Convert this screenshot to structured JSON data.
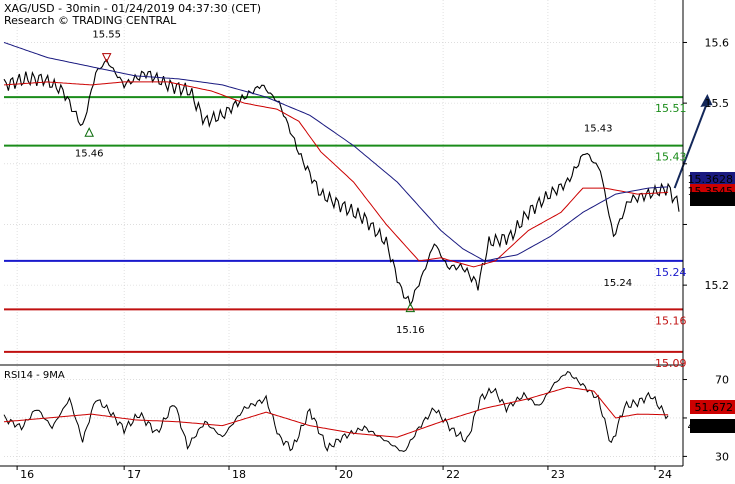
{
  "header": {
    "line1": "XAG/USD - 30min - 01/24/2019 04:37:30 (CET)",
    "line2": "Research © TRADING CENTRAL"
  },
  "colors": {
    "price": "#000000",
    "ma_fast": "#cc0000",
    "ma_slow": "#1a1a80",
    "resistance": "#1a8c1a",
    "pivot": "#1a1acc",
    "support": "#c01010",
    "arrow": "#14285a",
    "grid": "#cccccc",
    "rsi_line": "#000000",
    "rsi_ma": "#cc0000"
  },
  "chart_data": [
    {
      "type": "line",
      "name": "price-panel",
      "x_labels": [
        "16",
        "17",
        "18",
        "20",
        "22",
        "23",
        "24"
      ],
      "x_label_bar_index": [
        6,
        55,
        103,
        152,
        201,
        249,
        298
      ],
      "ylim": [
        15.07,
        15.67
      ],
      "y_ticks": [
        15.2,
        15.3,
        15.4,
        15.5,
        15.6
      ],
      "y_tick_labels": [
        "15.2",
        "",
        "",
        "15.5",
        "15.6"
      ],
      "grid": true,
      "series": [
        {
          "role": "price",
          "anchors": [
            [
              0,
              15.53
            ],
            [
              10,
              15.54
            ],
            [
              18,
              15.54
            ],
            [
              27,
              15.52
            ],
            [
              36,
              15.46
            ],
            [
              42,
              15.55
            ],
            [
              47,
              15.57
            ],
            [
              55,
              15.53
            ],
            [
              65,
              15.55
            ],
            [
              75,
              15.53
            ],
            [
              85,
              15.52
            ],
            [
              92,
              15.47
            ],
            [
              100,
              15.48
            ],
            [
              110,
              15.51
            ],
            [
              118,
              15.53
            ],
            [
              126,
              15.5
            ],
            [
              136,
              15.41
            ],
            [
              145,
              15.35
            ],
            [
              155,
              15.33
            ],
            [
              165,
              15.31
            ],
            [
              175,
              15.27
            ],
            [
              182,
              15.19
            ],
            [
              186,
              15.17
            ],
            [
              192,
              15.22
            ],
            [
              197,
              15.27
            ],
            [
              203,
              15.23
            ],
            [
              210,
              15.23
            ],
            [
              217,
              15.2
            ],
            [
              222,
              15.27
            ],
            [
              232,
              15.28
            ],
            [
              240,
              15.32
            ],
            [
              250,
              15.35
            ],
            [
              258,
              15.37
            ],
            [
              266,
              15.42
            ],
            [
              273,
              15.39
            ],
            [
              279,
              15.28
            ],
            [
              286,
              15.34
            ],
            [
              295,
              15.35
            ],
            [
              304,
              15.36
            ],
            [
              309,
              15.33
            ]
          ]
        },
        {
          "role": "ma_fast",
          "anchors": [
            [
              0,
              15.53
            ],
            [
              20,
              15.535
            ],
            [
              40,
              15.53
            ],
            [
              55,
              15.535
            ],
            [
              75,
              15.535
            ],
            [
              95,
              15.52
            ],
            [
              110,
              15.5
            ],
            [
              125,
              15.49
            ],
            [
              135,
              15.47
            ],
            [
              145,
              15.42
            ],
            [
              160,
              15.37
            ],
            [
              175,
              15.3
            ],
            [
              190,
              15.24
            ],
            [
              200,
              15.245
            ],
            [
              215,
              15.23
            ],
            [
              225,
              15.24
            ],
            [
              240,
              15.29
            ],
            [
              255,
              15.32
            ],
            [
              265,
              15.36
            ],
            [
              275,
              15.36
            ],
            [
              290,
              15.35
            ],
            [
              304,
              15.353
            ]
          ]
        },
        {
          "role": "ma_slow",
          "anchors": [
            [
              0,
              15.6
            ],
            [
              20,
              15.575
            ],
            [
              40,
              15.56
            ],
            [
              60,
              15.545
            ],
            [
              80,
              15.54
            ],
            [
              100,
              15.53
            ],
            [
              120,
              15.51
            ],
            [
              140,
              15.48
            ],
            [
              160,
              15.43
            ],
            [
              180,
              15.37
            ],
            [
              200,
              15.29
            ],
            [
              210,
              15.26
            ],
            [
              220,
              15.24
            ],
            [
              235,
              15.25
            ],
            [
              250,
              15.28
            ],
            [
              265,
              15.32
            ],
            [
              280,
              15.35
            ],
            [
              295,
              15.36
            ],
            [
              304,
              15.362
            ]
          ]
        }
      ],
      "levels": [
        {
          "value": 15.51,
          "label": "15.51",
          "role": "resistance"
        },
        {
          "value": 15.43,
          "label": "15.43",
          "role": "resistance"
        },
        {
          "value": 15.24,
          "label": "15.24",
          "role": "pivot"
        },
        {
          "value": 15.16,
          "label": "15.16",
          "role": "support"
        },
        {
          "value": 15.09,
          "label": "15.09",
          "role": "support"
        }
      ],
      "last_values": [
        {
          "value": 15.3628,
          "label": "15.3628",
          "role": "ma_slow"
        },
        {
          "value": 15.3545,
          "label": "15.3545",
          "role": "ma_fast"
        },
        {
          "value": 15.354,
          "label": "15.354",
          "role": "price"
        }
      ],
      "annotations": [
        {
          "text": "15.55",
          "bar": 47,
          "value": 15.575,
          "marker": "down-triangle",
          "label_value": 15.615
        },
        {
          "text": "15.46",
          "bar": 39,
          "value": 15.452,
          "marker": "up-triangle",
          "label_value": 15.419
        },
        {
          "text": "15.16",
          "bar": 186,
          "value": 15.163,
          "marker": "up-triangle",
          "label_value": 15.128
        },
        {
          "text": "15.43",
          "bar": 272,
          "value": 15.46,
          "marker": "",
          "label_value": 15.46
        },
        {
          "text": "15.24",
          "bar": 281,
          "value": 15.205,
          "marker": "",
          "label_value": 15.205
        }
      ],
      "projection": {
        "from": [
          307,
          15.36
        ],
        "to": [
          322,
          15.515
        ]
      }
    },
    {
      "type": "line",
      "name": "rsi-panel",
      "title": "RSI14 - 9MA",
      "ylim": [
        25,
        76
      ],
      "y_ticks": [
        30,
        50,
        70
      ],
      "y_tick_labels": [
        "30",
        "",
        "70"
      ],
      "series": [
        {
          "role": "rsi_line",
          "anchors": [
            [
              0,
              50
            ],
            [
              8,
              45
            ],
            [
              15,
              55
            ],
            [
              22,
              45
            ],
            [
              30,
              60
            ],
            [
              36,
              38
            ],
            [
              42,
              60
            ],
            [
              48,
              54
            ],
            [
              55,
              44
            ],
            [
              62,
              52
            ],
            [
              70,
              42
            ],
            [
              78,
              58
            ],
            [
              84,
              35
            ],
            [
              92,
              48
            ],
            [
              100,
              40
            ],
            [
              110,
              55
            ],
            [
              120,
              60
            ],
            [
              126,
              40
            ],
            [
              132,
              34
            ],
            [
              140,
              54
            ],
            [
              148,
              34
            ],
            [
              155,
              40
            ],
            [
              165,
              45
            ],
            [
              175,
              38
            ],
            [
              183,
              32
            ],
            [
              190,
              45
            ],
            [
              197,
              55
            ],
            [
              205,
              44
            ],
            [
              212,
              38
            ],
            [
              218,
              60
            ],
            [
              224,
              65
            ],
            [
              230,
              55
            ],
            [
              238,
              62
            ],
            [
              245,
              56
            ],
            [
              252,
              68
            ],
            [
              258,
              74
            ],
            [
              266,
              66
            ],
            [
              272,
              60
            ],
            [
              278,
              36
            ],
            [
              284,
              56
            ],
            [
              290,
              58
            ],
            [
              296,
              62
            ],
            [
              304,
              50
            ]
          ]
        },
        {
          "role": "rsi_ma",
          "anchors": [
            [
              0,
              48
            ],
            [
              20,
              50
            ],
            [
              40,
              52
            ],
            [
              60,
              49
            ],
            [
              80,
              48
            ],
            [
              100,
              46
            ],
            [
              120,
              53
            ],
            [
              140,
              46
            ],
            [
              160,
              42
            ],
            [
              180,
              40
            ],
            [
              200,
              48
            ],
            [
              220,
              55
            ],
            [
              240,
              60
            ],
            [
              258,
              66
            ],
            [
              270,
              64
            ],
            [
              280,
              50
            ],
            [
              290,
              52
            ],
            [
              304,
              51.67
            ]
          ]
        }
      ],
      "last_values": [
        {
          "value": 51.672,
          "label": "51.672",
          "role": "rsi_ma"
        },
        {
          "value": 49.8883,
          "label": "49.8883",
          "role": "rsi_line"
        }
      ]
    }
  ]
}
